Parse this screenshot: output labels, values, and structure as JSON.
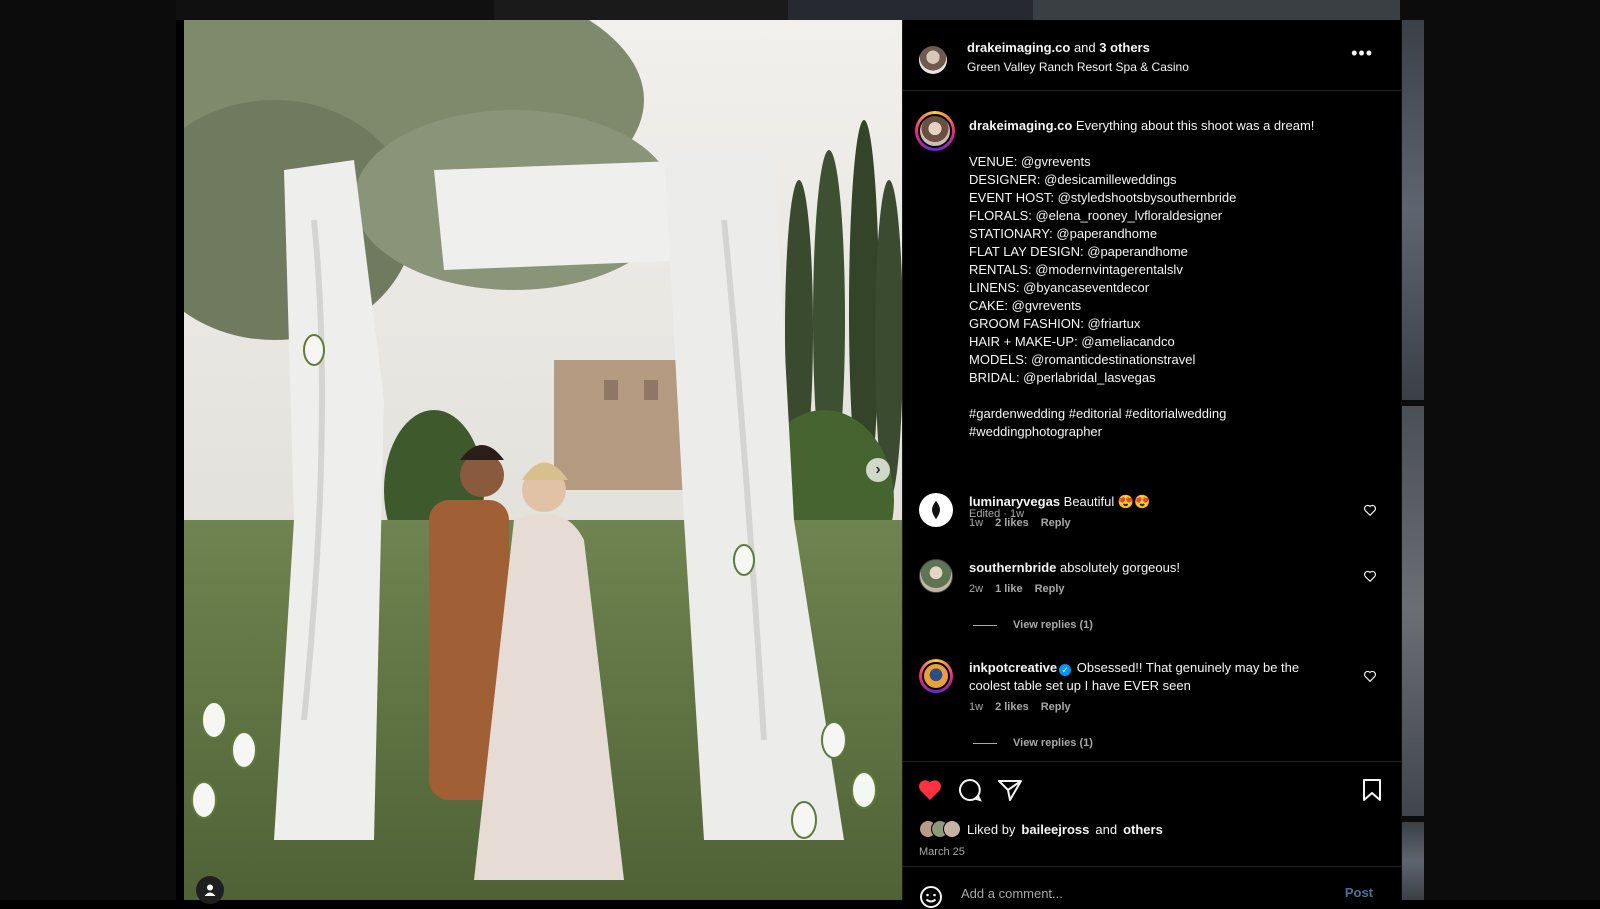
{
  "post": {
    "author": "drakeimaging.co",
    "coauthors_text": "and",
    "coauthors_count": "3 others",
    "location": "Green Valley Ranch Resort Spa & Casino"
  },
  "caption": {
    "username": "drakeimaging.co",
    "text": " Everything about this shoot was a dream!\n\nVENUE: @gvrevents\nDESIGNER: @desicamilleweddings\nEVENT HOST: @styledshootsbysouthernbride\nFLORALS: @elena_rooney_lvfloraldesigner\nSTATIONARY: @paperandhome\nFLAT LAY DESIGN: @paperandhome\nRENTALS: @modernvintagerentalslv\nLINENS: @byancaseventdecor\nCAKE: @gvrevents\nGROOM FASHION: @friartux\nHAIR + MAKE-UP: @ameliacandco\nMODELS: @romanticdestinationstravel\nBRIDAL: @perlabridal_lasvegas\n\n#gardenwedding #editorial #editorialwedding\n#weddingphotographer",
    "meta": "Edited · 1w"
  },
  "comments": [
    {
      "username": "luminaryvegas",
      "text": " Beautiful 😍😍",
      "time": "1w",
      "likes": "2 likes",
      "reply": "Reply",
      "view_replies": ""
    },
    {
      "username": "southernbride",
      "text": " absolutely gorgeous!",
      "time": "2w",
      "likes": "1 like",
      "reply": "Reply",
      "view_replies": "View replies (1)"
    },
    {
      "username": "inkpotcreative",
      "text": " Obsessed!! That genuinely may be the coolest table set up I have EVER seen",
      "time": "1w",
      "likes": "2 likes",
      "reply": "Reply",
      "view_replies": "View replies (1)"
    }
  ],
  "likes": {
    "prefix": "Liked by",
    "user": "baileejross",
    "middle": "and",
    "others": "others"
  },
  "date": "March 25",
  "comment_box": {
    "placeholder": "Add a comment...",
    "post_label": "Post"
  },
  "colors": {
    "like_red": "#ff3040",
    "verified_blue": "#0095f6",
    "post_button": "#4d6f9e"
  },
  "icons": {
    "next": "chevron-right-icon",
    "more": "more-horizontal-icon",
    "like": "heart-filled-icon",
    "comment": "comment-icon",
    "share": "paper-plane-icon",
    "save": "bookmark-icon",
    "emoji": "smiley-icon",
    "tag": "user-tag-icon"
  }
}
